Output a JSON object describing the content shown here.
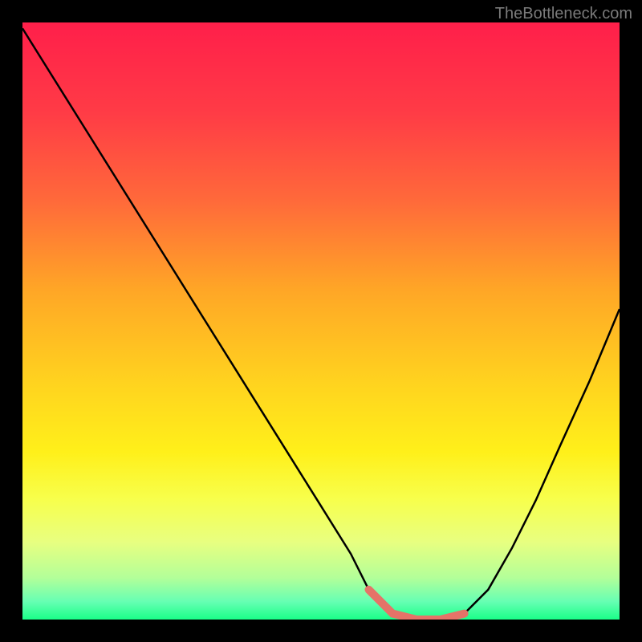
{
  "watermark": "TheBottleneck.com",
  "chart_data": {
    "type": "line",
    "title": "",
    "xlabel": "",
    "ylabel": "",
    "xlim": [
      0,
      100
    ],
    "ylim": [
      0,
      100
    ],
    "series": [
      {
        "name": "curve",
        "x": [
          0,
          5,
          10,
          15,
          20,
          25,
          30,
          35,
          40,
          45,
          50,
          55,
          58,
          62,
          66,
          70,
          74,
          78,
          82,
          86,
          90,
          95,
          100
        ],
        "y": [
          99,
          91,
          83,
          75,
          67,
          59,
          51,
          43,
          35,
          27,
          19,
          11,
          5,
          1,
          0,
          0,
          1,
          5,
          12,
          20,
          29,
          40,
          52
        ]
      }
    ],
    "highlight_segment": {
      "color": "#e57368",
      "x": [
        58,
        62,
        66,
        70,
        74
      ],
      "y": [
        5,
        1,
        0,
        0,
        1
      ]
    },
    "gradient_stops": [
      {
        "offset": 0.0,
        "color": "#ff1f4a"
      },
      {
        "offset": 0.15,
        "color": "#ff3b46"
      },
      {
        "offset": 0.3,
        "color": "#ff6a3a"
      },
      {
        "offset": 0.45,
        "color": "#ffa726"
      },
      {
        "offset": 0.6,
        "color": "#ffd21f"
      },
      {
        "offset": 0.72,
        "color": "#fff01a"
      },
      {
        "offset": 0.8,
        "color": "#f7ff4d"
      },
      {
        "offset": 0.87,
        "color": "#e8ff80"
      },
      {
        "offset": 0.93,
        "color": "#b3ff99"
      },
      {
        "offset": 0.97,
        "color": "#66ffb3"
      },
      {
        "offset": 1.0,
        "color": "#1aff88"
      }
    ]
  }
}
